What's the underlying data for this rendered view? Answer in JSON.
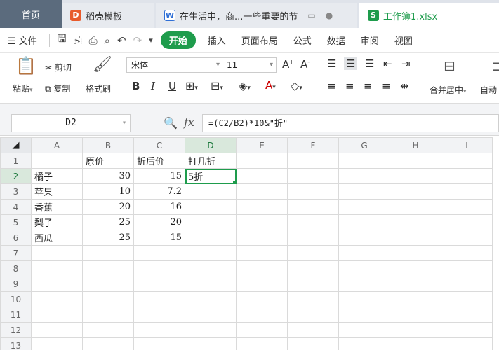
{
  "tabs": [
    {
      "label": "首页",
      "active": false
    },
    {
      "label": "稻壳模板",
      "icon": "daoke-icon",
      "color": "#e85a2b"
    },
    {
      "label": "在生活中，商...一些重要的节",
      "icon": "word-doc-icon",
      "color": "#2f6fd6"
    },
    {
      "label": "工作簿1.xlsx",
      "icon": "spreadsheet-icon",
      "color": "#1e9c4c",
      "active": true
    }
  ],
  "menu": {
    "file_label": "文件",
    "start_label": "开始",
    "items": [
      "插入",
      "页面布局",
      "公式",
      "数据",
      "审阅",
      "视图"
    ]
  },
  "ribbon": {
    "paste_label": "粘贴",
    "cut_label": "剪切",
    "copy_label": "复制",
    "format_painter_label": "格式刷",
    "font_name": "宋体",
    "font_size": "11",
    "merge_center_label": "合并居中",
    "auto_label": "自动"
  },
  "formula_bar": {
    "name_box": "D2",
    "fx_label": "fx",
    "formula": "=(C2/B2)*10&\"折\""
  },
  "grid": {
    "columns": [
      "A",
      "B",
      "C",
      "D",
      "E",
      "F",
      "G",
      "H",
      "I"
    ],
    "active_column": "D",
    "active_row": 2,
    "rows": [
      {
        "n": "1",
        "cells": [
          "",
          "原价",
          "折后价",
          "打几折",
          "",
          "",
          "",
          "",
          ""
        ]
      },
      {
        "n": "2",
        "cells": [
          "橘子",
          "30",
          "15",
          "5折",
          "",
          "",
          "",
          "",
          ""
        ]
      },
      {
        "n": "3",
        "cells": [
          "苹果",
          "10",
          "7.2",
          "",
          "",
          "",
          "",
          "",
          ""
        ]
      },
      {
        "n": "4",
        "cells": [
          "香蕉",
          "20",
          "16",
          "",
          "",
          "",
          "",
          "",
          ""
        ]
      },
      {
        "n": "5",
        "cells": [
          "梨子",
          "25",
          "20",
          "",
          "",
          "",
          "",
          "",
          ""
        ]
      },
      {
        "n": "6",
        "cells": [
          "西瓜",
          "25",
          "15",
          "",
          "",
          "",
          "",
          "",
          ""
        ]
      },
      {
        "n": "7",
        "cells": [
          "",
          "",
          "",
          "",
          "",
          "",
          "",
          "",
          ""
        ]
      },
      {
        "n": "8",
        "cells": [
          "",
          "",
          "",
          "",
          "",
          "",
          "",
          "",
          ""
        ]
      },
      {
        "n": "9",
        "cells": [
          "",
          "",
          "",
          "",
          "",
          "",
          "",
          "",
          ""
        ]
      },
      {
        "n": "10",
        "cells": [
          "",
          "",
          "",
          "",
          "",
          "",
          "",
          "",
          ""
        ]
      },
      {
        "n": "11",
        "cells": [
          "",
          "",
          "",
          "",
          "",
          "",
          "",
          "",
          ""
        ]
      },
      {
        "n": "12",
        "cells": [
          "",
          "",
          "",
          "",
          "",
          "",
          "",
          "",
          ""
        ]
      },
      {
        "n": "13",
        "cells": [
          "",
          "",
          "",
          "",
          "",
          "",
          "",
          "",
          ""
        ]
      }
    ]
  },
  "colors": {
    "accent": "#1e9c4c",
    "home_tab": "#5b6b7d"
  }
}
